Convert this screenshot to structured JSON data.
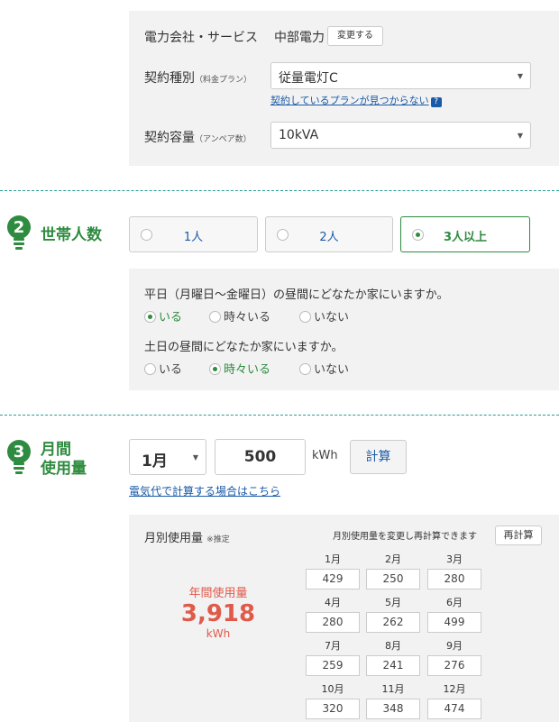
{
  "contract": {
    "company_label": "電力会社・サービス",
    "company_value": "中部電力",
    "change_button": "変更する",
    "plan_label": "契約種別",
    "plan_label_note": "（料金プラン）",
    "plan_value": "従量電灯C",
    "plan_not_found_link": "契約しているプランが見つからない",
    "help_icon": "?",
    "capacity_label": "契約容量",
    "capacity_label_note": "（アンペア数）",
    "capacity_value": "10kVA"
  },
  "household": {
    "step_number": "2",
    "title": "世帯人数",
    "options": [
      {
        "label": "1人",
        "selected": false
      },
      {
        "label": "2人",
        "selected": false
      },
      {
        "label": "3人以上",
        "selected": true
      }
    ],
    "weekday_question": "平日（月曜日〜金曜日）の昼間にどなたか家にいますか。",
    "weekday_options": [
      {
        "label": "いる",
        "selected": true
      },
      {
        "label": "時々いる",
        "selected": false
      },
      {
        "label": "いない",
        "selected": false
      }
    ],
    "weekend_question": "土日の昼間にどなたか家にいますか。",
    "weekend_options": [
      {
        "label": "いる",
        "selected": false
      },
      {
        "label": "時々いる",
        "selected": true
      },
      {
        "label": "いない",
        "selected": false
      }
    ]
  },
  "usage": {
    "step_number": "3",
    "title_line1": "月間",
    "title_line2": "使用量",
    "month_value": "1月",
    "kwh_value": "500",
    "kwh_unit": "kWh",
    "calc_button": "計算",
    "bill_link": "電気代で計算する場合はこちら",
    "monthly_title": "月別使用量",
    "monthly_note": "※推定",
    "recalc_text": "月別使用量を変更し再計算できます",
    "recalc_button": "再計算",
    "annual_label": "年間使用量",
    "annual_value": "3,918",
    "annual_unit": "kWh",
    "months": [
      {
        "label": "1月",
        "value": "429"
      },
      {
        "label": "2月",
        "value": "250"
      },
      {
        "label": "3月",
        "value": "280"
      },
      {
        "label": "4月",
        "value": "280"
      },
      {
        "label": "5月",
        "value": "262"
      },
      {
        "label": "6月",
        "value": "499"
      },
      {
        "label": "7月",
        "value": "259"
      },
      {
        "label": "8月",
        "value": "241"
      },
      {
        "label": "9月",
        "value": "276"
      },
      {
        "label": "10月",
        "value": "320"
      },
      {
        "label": "11月",
        "value": "348"
      },
      {
        "label": "12月",
        "value": "474"
      }
    ]
  },
  "colors": {
    "accent_green": "#2e8b3f",
    "link_blue": "#1a5aa8",
    "annual_red": "#e05a4a",
    "divider": "#2a9d8f"
  }
}
